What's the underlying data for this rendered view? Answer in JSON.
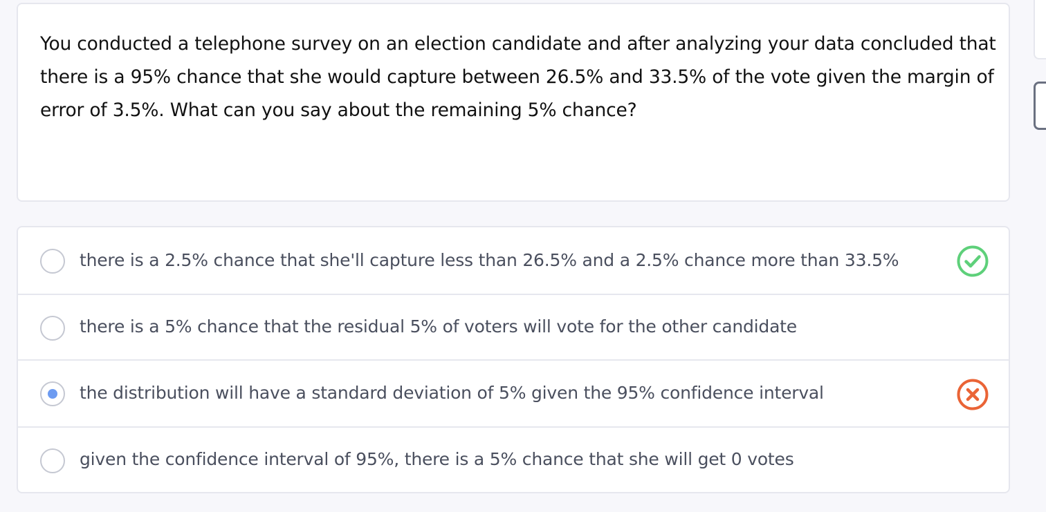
{
  "question": {
    "text": "You conducted a telephone survey on an election candidate and after analyzing your data concluded that there is a 95% chance that she would capture between 26.5% and 33.5% of the vote given the margin of error of 3.5%. What can you say about the remaining 5% chance?"
  },
  "options": [
    {
      "label": "there is a 2.5% chance that she'll capture less than 26.5% and a 2.5% chance more than 33.5%",
      "selected": false,
      "status": "correct",
      "status_icon": "check-circle-icon"
    },
    {
      "label": "there is a 5% chance that the residual 5% of voters will vote for the other candidate",
      "selected": false,
      "status": "none"
    },
    {
      "label": "the distribution will have a standard deviation of 5% given the 95% confidence interval",
      "selected": true,
      "status": "incorrect",
      "status_icon": "x-circle-icon"
    },
    {
      "label": "given the confidence interval of 95%, there is a 5% chance that she will get 0 votes",
      "selected": false,
      "status": "none"
    }
  ],
  "colors": {
    "correct": "#5ed07a",
    "incorrect": "#ea6436",
    "selected_radio": "#6d9bf1",
    "background": "#f7f7fb"
  }
}
